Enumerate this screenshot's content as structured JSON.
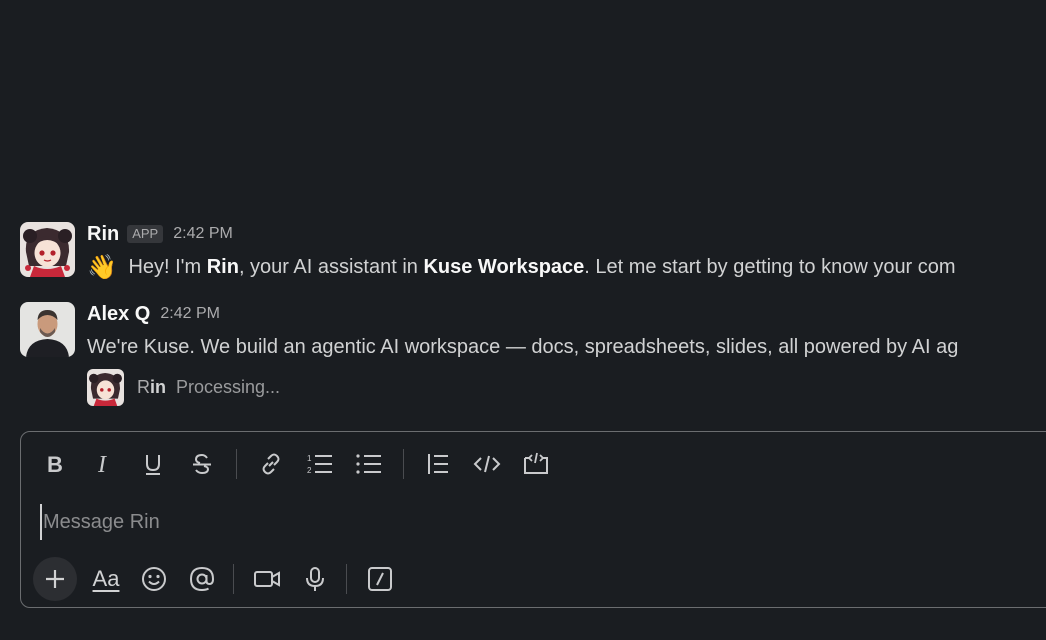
{
  "messages": [
    {
      "sender": "Rin",
      "badge": "APP",
      "time": "2:42 PM",
      "emoji": "👋",
      "parts": {
        "p1": " Hey! I'm ",
        "b1": "Rin",
        "p2": ", your AI assistant in ",
        "b2": "Kuse Workspace",
        "p3": ". Let me start by getting to know your com"
      }
    },
    {
      "sender": "Alex Q",
      "time": "2:42 PM",
      "text": "We're Kuse. We build an agentic AI workspace — docs, spreadsheets, slides, all powered by AI ag"
    }
  ],
  "processing": {
    "name_prefix": "R",
    "name_rest": "in",
    "status": "Processing..."
  },
  "composer": {
    "placeholder": "Message Rin",
    "value": "",
    "format_label": "Aa"
  },
  "icons": {
    "bold": "bold-icon",
    "italic": "italic-icon",
    "underline": "underline-icon",
    "strike": "strikethrough-icon",
    "link": "link-icon",
    "ordered_list": "ordered-list-icon",
    "bullet_list": "bullet-list-icon",
    "blockquote": "blockquote-icon",
    "code": "code-icon",
    "code_block": "code-block-icon",
    "plus": "plus-icon",
    "emoji": "emoji-icon",
    "mention": "mention-icon",
    "video": "video-icon",
    "mic": "microphone-icon",
    "slash": "slash-command-icon"
  }
}
